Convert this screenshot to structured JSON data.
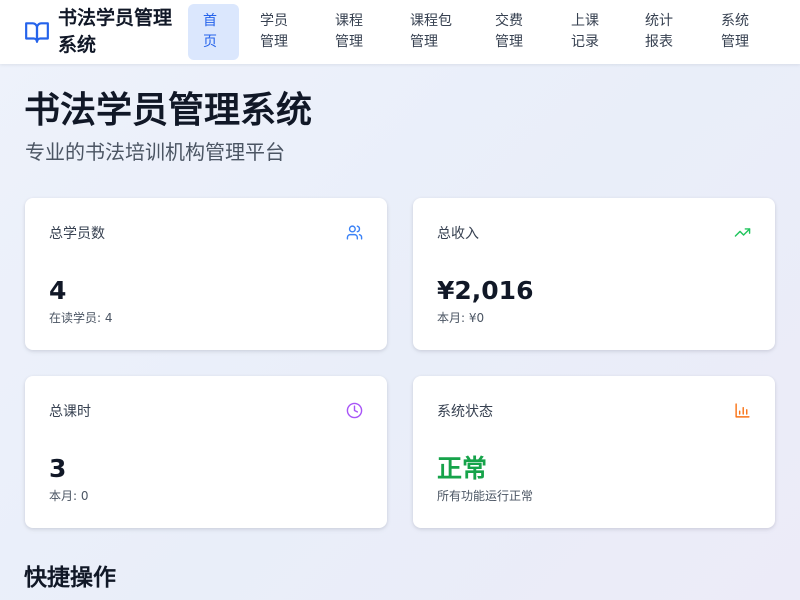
{
  "header": {
    "brand_title": "书法学员管理系统",
    "brand_icon": "open-book-icon",
    "nav": [
      {
        "label": "首页",
        "active": true
      },
      {
        "label": "学员管理",
        "active": false
      },
      {
        "label": "课程管理",
        "active": false
      },
      {
        "label": "课程包管理",
        "active": false
      },
      {
        "label": "交费管理",
        "active": false
      },
      {
        "label": "上课记录",
        "active": false
      },
      {
        "label": "统计报表",
        "active": false
      },
      {
        "label": "系统管理",
        "active": false
      }
    ]
  },
  "main": {
    "title": "书法学员管理系统",
    "subtitle": "专业的书法培训机构管理平台",
    "stats": [
      {
        "label": "总学员数",
        "value": "4",
        "sub": "在读学员: 4",
        "icon": "users-icon",
        "icon_color": "#3b82f6"
      },
      {
        "label": "总收入",
        "value": "¥2,016",
        "sub": "本月: ¥0",
        "icon": "trending-up-icon",
        "icon_color": "#22c55e"
      },
      {
        "label": "总课时",
        "value": "3",
        "sub": "本月: 0",
        "icon": "clock-icon",
        "icon_color": "#a855f7"
      },
      {
        "label": "系统状态",
        "value": "正常",
        "sub": "所有功能运行正常",
        "icon": "bar-chart-icon",
        "icon_color": "#f97316",
        "value_color": "#16a34a"
      }
    ],
    "quick_actions_title": "快捷操作"
  },
  "colors": {
    "accent": "#2563eb",
    "nav_active_bg": "#dbe7fd",
    "success": "#16a34a"
  }
}
